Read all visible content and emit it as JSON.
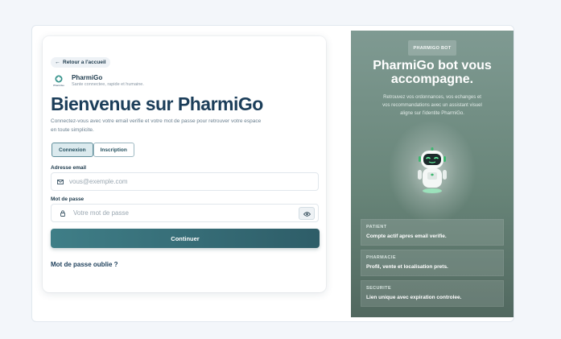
{
  "login": {
    "back_label": "Retour a l'accueil",
    "brand_name": "PharmiGo",
    "brand_tagline": "Sante connectee, rapide et humaine.",
    "logo_text": "PharmiGo",
    "title": "Bienvenue sur PharmiGo",
    "subtitle": "Connectez-vous avec votre email verifie et votre mot de passe pour retrouver votre espace en toute simplicite.",
    "tabs": [
      {
        "label": "Connexion",
        "active": true
      },
      {
        "label": "Inscription",
        "active": false
      }
    ],
    "email_label": "Adresse email",
    "email_placeholder": "vous@exemple.com",
    "email_value": "",
    "password_label": "Mot de passe",
    "password_placeholder": "Votre mot de passe",
    "password_value": "",
    "submit_label": "Continuer",
    "forgot_label": "Mot de passe oublie ?"
  },
  "panel": {
    "badge": "PHARMIGO BOT",
    "title": "PharmiGo bot vous accompagne.",
    "description": "Retrouvez vos ordonnances, vos echanges et vos recommandations avec un assistant visuel aligne sur l'identite PharmiGo.",
    "cards": [
      {
        "key": "PATIENT",
        "value": "Compte actif apres email verifie."
      },
      {
        "key": "PHARMACIE",
        "value": "Profil, vente et localisation prets."
      },
      {
        "key": "SECURITE",
        "value": "Lien unique avec expiration controlee."
      }
    ]
  },
  "icons": {
    "back": "arrow-left-icon",
    "email": "mail-icon",
    "password": "lock-icon",
    "toggle_password": "eye-icon",
    "robot": "robot-icon"
  },
  "colors": {
    "primary": "#2e5d68",
    "title": "#1c3e5a",
    "panel": "#688579"
  }
}
